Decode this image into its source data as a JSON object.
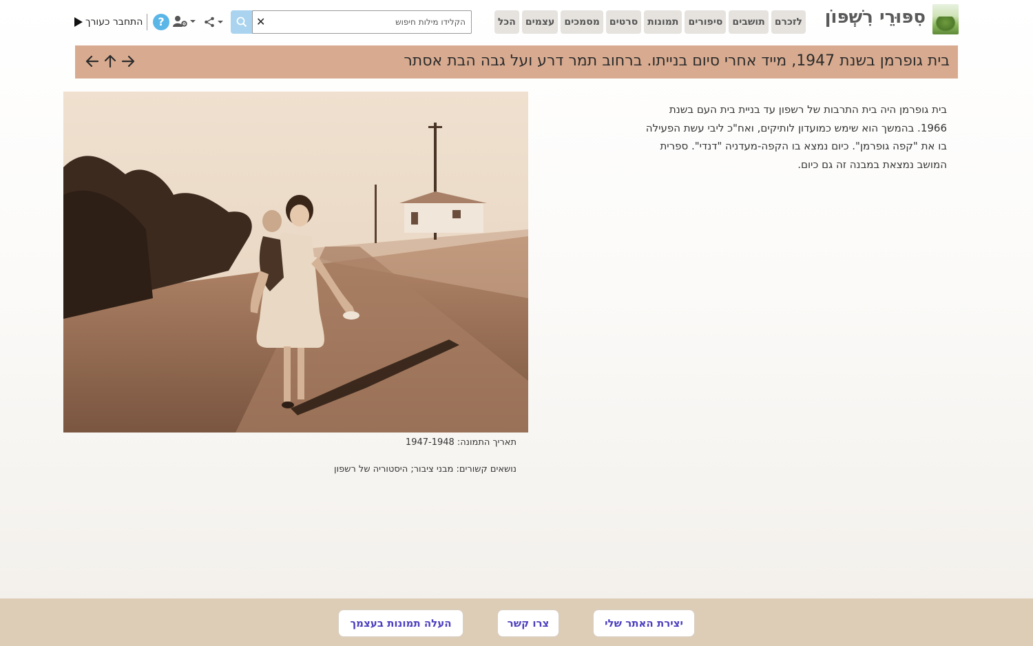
{
  "header": {
    "site_title": "סִפּוּרֵי רִשְׁפּוֹן",
    "nav": [
      {
        "label": "לזכרם"
      },
      {
        "label": "תושבים"
      },
      {
        "label": "סיפורים"
      },
      {
        "label": "תמונות"
      },
      {
        "label": "סרטים"
      },
      {
        "label": "מסמכים"
      },
      {
        "label": "עצמים"
      },
      {
        "label": "הכל"
      }
    ],
    "search": {
      "placeholder": "הקלידו מילות חיפוש",
      "value": ""
    },
    "help_label": "?",
    "editor_login": "התחבר כעורך"
  },
  "page": {
    "title": "בית גופרמן בשנת 1947, מייד אחרי סיום בנייתו. ברחוב תמר דרע ועל גבה הבת אסתר",
    "description_lines": [
      "בית גופרמן היה בית התרבות של רשפון עד בניית בית העם בשנת",
      "1966. בהמשך הוא שימש כמועדון לותיקים, ואח\"כ ליבי עשת הפעילה",
      "בו את \"קפה גופרמן\". כיום נמצא בו הקפה-מעדניה \"דנדי\". ספרית",
      "המושב נמצאת במבנה זה גם כיום."
    ],
    "photo_date": "תאריך התמונה: 1947-1948",
    "related_topics": "נושאים קשורים: מבני ציבור; היסטוריה של רשפון"
  },
  "footer": {
    "create_site": "יצירת האתר שלי",
    "contact": "צרו קשר",
    "upload": "העלה תמונות בעצמך"
  },
  "colors": {
    "title_bar": "#d8ab90",
    "footer": "#ddcdb6",
    "footer_link": "#4c3fbf",
    "search_button": "#a9d3ee",
    "help": "#5bb6e8"
  }
}
